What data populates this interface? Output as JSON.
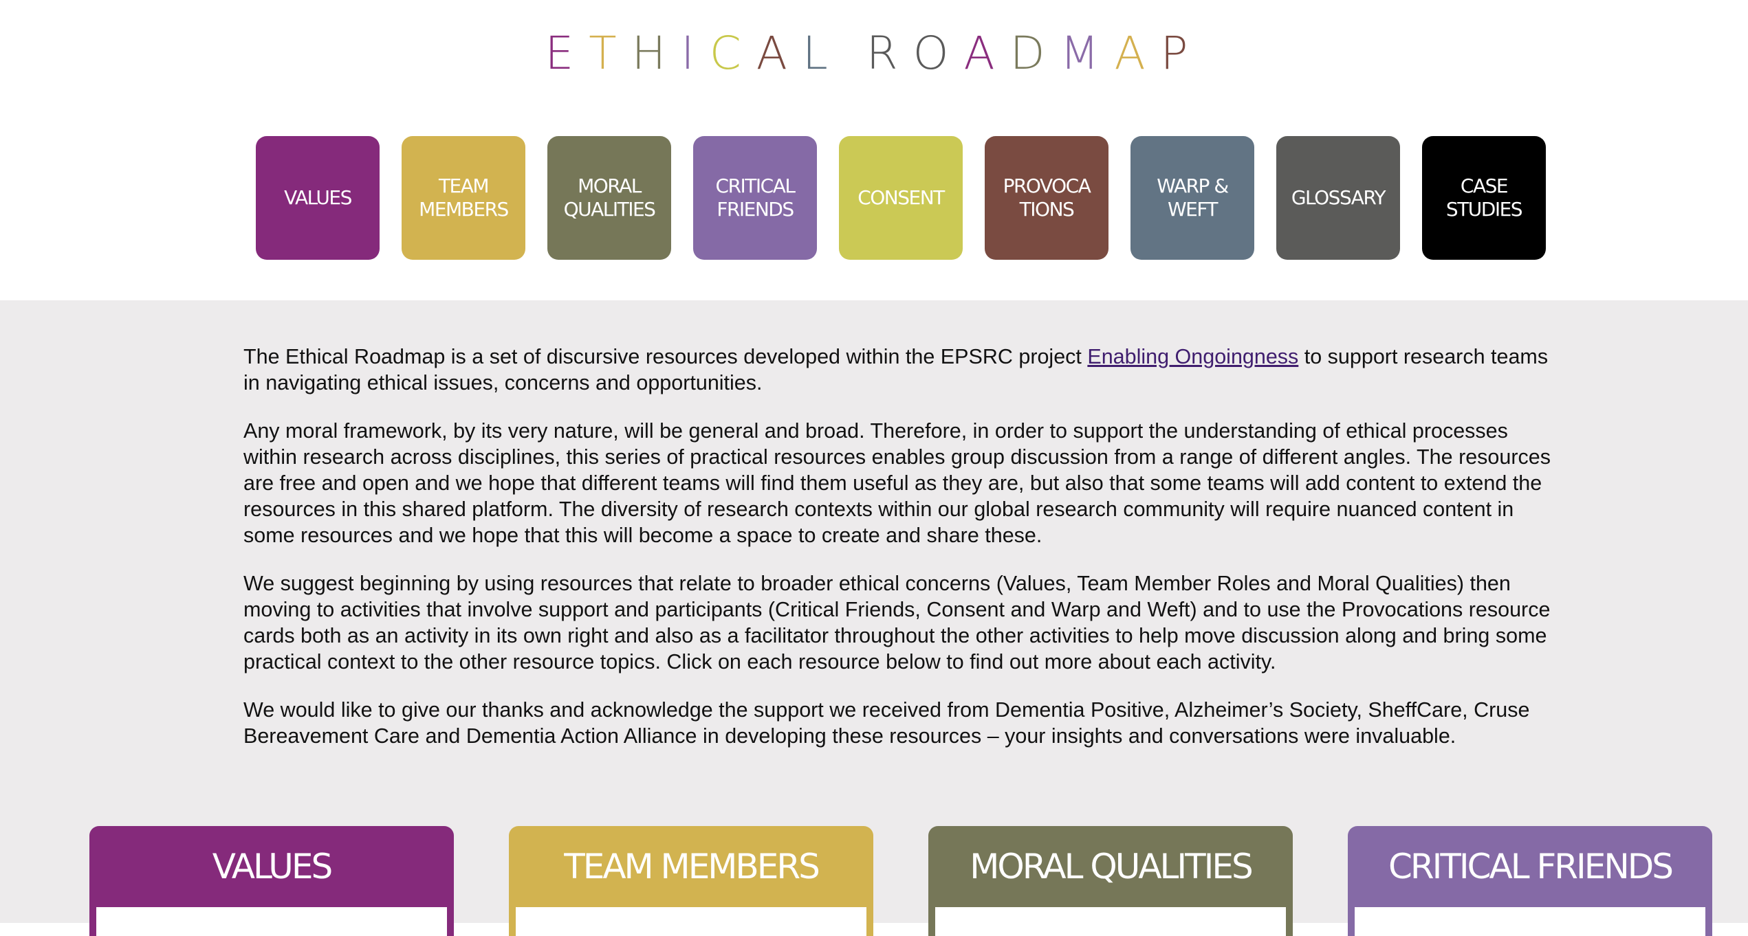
{
  "logo": {
    "word1": [
      {
        "ch": "E",
        "color": "#8a2d7e"
      },
      {
        "ch": "T",
        "color": "#d4b04f"
      },
      {
        "ch": "H",
        "color": "#7a7a5c"
      },
      {
        "ch": "I",
        "color": "#8a6ba8"
      },
      {
        "ch": "C",
        "color": "#c8c84a"
      },
      {
        "ch": "A",
        "color": "#7a4a40"
      },
      {
        "ch": "L",
        "color": "#5f7282"
      }
    ],
    "word2": [
      {
        "ch": "R",
        "color": "#5a5a5a"
      },
      {
        "ch": "O",
        "color": "#5a5a5a"
      },
      {
        "ch": "A",
        "color": "#8a2d7e"
      },
      {
        "ch": "D",
        "color": "#7a7a5c"
      },
      {
        "ch": "M",
        "color": "#8a6ba8"
      },
      {
        "ch": "A",
        "color": "#d4b04f"
      },
      {
        "ch": "P",
        "color": "#7a4a40"
      }
    ]
  },
  "nav": [
    {
      "lines": [
        "VALUES"
      ],
      "color": "#852a7b"
    },
    {
      "lines": [
        "TEAM",
        "MEMBERS"
      ],
      "color": "#d2b350"
    },
    {
      "lines": [
        "MORAL",
        "QUALITIES"
      ],
      "color": "#767758"
    },
    {
      "lines": [
        "CRITICAL",
        "FRIENDS"
      ],
      "color": "#856aa6"
    },
    {
      "lines": [
        "CONSENT"
      ],
      "color": "#cbc955"
    },
    {
      "lines": [
        "PROVOCA",
        "TIONS"
      ],
      "color": "#7a4b41"
    },
    {
      "lines": [
        "WARP &",
        "WEFT"
      ],
      "color": "#627484"
    },
    {
      "lines": [
        "GLOSSARY"
      ],
      "color": "#5b5b59"
    },
    {
      "lines": [
        "CASE",
        "STUDIES"
      ],
      "color": "#000000"
    }
  ],
  "intro": {
    "p1_before": "The Ethical Roadmap is a set of discursive resources developed within the EPSRC project ",
    "p1_link": "Enabling Ongoingness",
    "p1_after": " to support research teams in navigating ethical issues, concerns and opportunities.",
    "p2": "Any moral framework, by its very nature, will be general and broad. Therefore, in order to support the understanding of ethical processes within research across disciplines, this series of practical resources enables group discussion from a range of different angles. The resources are free and open and we hope that different teams will find them useful as they are, but also that some teams will add content to extend the resources in this shared platform. The diversity of research contexts within our global research community will require nuanced content in some resources and we hope that this will become a space to create and share these.",
    "p3": "We suggest beginning by using resources that relate to broader ethical concerns (Values, Team Member Roles and Moral Qualities) then moving to activities that involve support and participants (Critical Friends, Consent and Warp and Weft) and to use the Provocations resource cards both as an activity in its own right and also as a facilitator throughout the other activities to help move discussion along and bring some practical context to the other resource topics. Click on each resource below to find out more about each activity.",
    "p4": "We would like to give our thanks and acknowledge the support we received from Dementia Positive, Alzheimer’s Society, SheffCare, Cruse Bereavement Care and Dementia Action Alliance in developing these resources – your insights and conversations were invaluable."
  },
  "cards": [
    {
      "title": "VALUES",
      "color": "#852a7b"
    },
    {
      "title": "TEAM MEMBERS",
      "color": "#d2b350"
    },
    {
      "title": "MORAL QUALITIES",
      "color": "#767758"
    },
    {
      "title": "CRITICAL FRIENDS",
      "color": "#856aa6"
    }
  ]
}
